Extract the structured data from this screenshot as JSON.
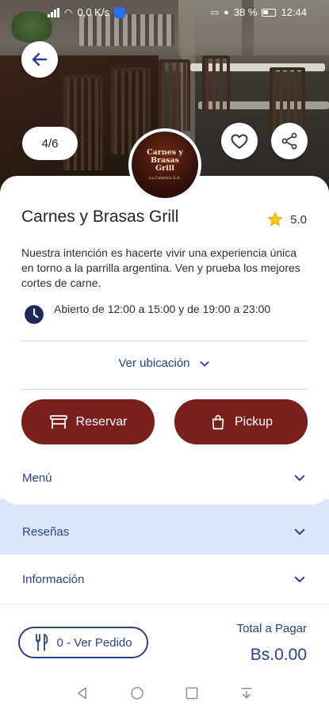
{
  "status_bar": {
    "net_speed": "0,0 K/s",
    "battery": "38 %",
    "time": "12:44"
  },
  "hero": {
    "photo_counter": "4/6",
    "logo": {
      "line1": "Carnes y Brasas",
      "line2": "Grill",
      "line3": "La Cabrera S.A."
    }
  },
  "restaurant": {
    "name": "Carnes y Brasas Grill",
    "rating": "5.0",
    "description": "Nuestra intención es hacerte vivir una experiencia única en torno a la parrilla argentina. Ven y prueba los mejores cortes de carne.",
    "hours": "Abierto de 12:00 a 15:00 y de 19:00 a 23:00",
    "location_label": "Ver ubicación"
  },
  "actions": {
    "reserve_label": "Reservar",
    "pickup_label": "Pickup"
  },
  "sections": [
    {
      "label": "Menú"
    },
    {
      "label": "Reseñas"
    },
    {
      "label": "Información"
    }
  ],
  "order": {
    "button_label": "0 - Ver Pedido",
    "total_label": "Total a Pagar",
    "total_value": "Bs.0.00"
  },
  "colors": {
    "brand_red": "#7b1e1e",
    "brand_blue": "#27418f",
    "highlight_bg": "#d9e6fb",
    "star": "#f5c518"
  },
  "icons": [
    "back-arrow-icon",
    "heart-icon",
    "share-icon",
    "star-icon",
    "clock-icon",
    "chevron-down-icon",
    "table-icon",
    "shopping-bag-icon",
    "cutlery-icon"
  ]
}
